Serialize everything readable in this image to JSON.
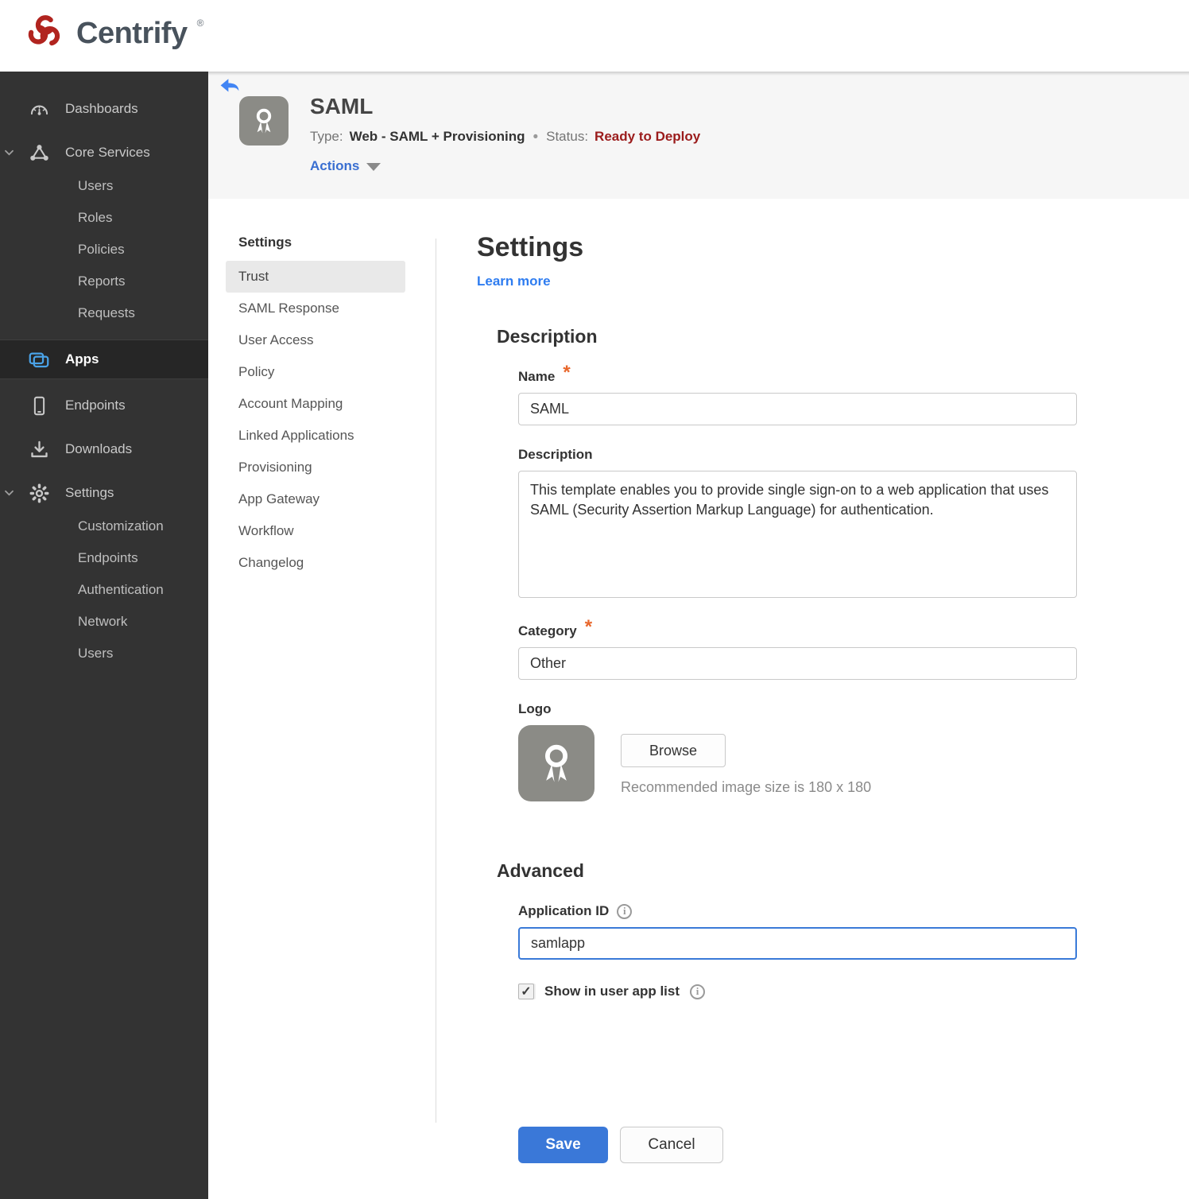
{
  "brand": {
    "name": "Centrify",
    "trademark": "®"
  },
  "colors": {
    "brand_red": "#b1241f",
    "sidebar_bg": "#333333",
    "sidebar_active_bg": "#262626",
    "apps_icon_blue": "#4aa3e8",
    "accent_blue": "#3a78d8",
    "link_blue": "#2e7cf0",
    "status_red": "#9b1c1c",
    "required_orange": "#e8672c"
  },
  "icons": {
    "info": "i",
    "checkmark": "✓",
    "meta_dot": "•"
  },
  "sidebar": {
    "items": [
      {
        "label": "Dashboards",
        "icon": "dashboards",
        "type": "top"
      },
      {
        "label": "Core Services",
        "icon": "core-services",
        "type": "top",
        "expanded": true
      },
      {
        "label": "Users",
        "type": "sub"
      },
      {
        "label": "Roles",
        "type": "sub"
      },
      {
        "label": "Policies",
        "type": "sub"
      },
      {
        "label": "Reports",
        "type": "sub"
      },
      {
        "label": "Requests",
        "type": "sub"
      },
      {
        "label": "Apps",
        "icon": "apps",
        "type": "top",
        "active": true
      },
      {
        "label": "Endpoints",
        "icon": "endpoints",
        "type": "top"
      },
      {
        "label": "Downloads",
        "icon": "downloads",
        "type": "top"
      },
      {
        "label": "Settings",
        "icon": "settings",
        "type": "top",
        "expanded": true
      },
      {
        "label": "Customization",
        "type": "sub"
      },
      {
        "label": "Endpoints",
        "type": "sub"
      },
      {
        "label": "Authentication",
        "type": "sub"
      },
      {
        "label": "Network",
        "type": "sub"
      },
      {
        "label": "Users",
        "type": "sub"
      }
    ]
  },
  "app_header": {
    "title": "SAML",
    "type_label": "Type:",
    "type_value": "Web - SAML + Provisioning",
    "status_label": "Status:",
    "status_value": "Ready to Deploy",
    "actions_label": "Actions"
  },
  "subnav": {
    "header": "Settings",
    "selected": "Trust",
    "items": [
      "Trust",
      "SAML Response",
      "User Access",
      "Policy",
      "Account Mapping",
      "Linked Applications",
      "Provisioning",
      "App Gateway",
      "Workflow",
      "Changelog"
    ]
  },
  "main": {
    "title": "Settings",
    "learn_more": "Learn more",
    "description_section": {
      "heading": "Description",
      "name_label": "Name",
      "name_value": "SAML",
      "description_label": "Description",
      "description_value": "This template enables you to provide single sign-on to a web application that uses SAML (Security Assertion Markup Language) for authentication.",
      "category_label": "Category",
      "category_value": "Other",
      "logo_label": "Logo",
      "browse_label": "Browse",
      "logo_hint": "Recommended image size is 180 x 180"
    },
    "advanced_section": {
      "heading": "Advanced",
      "application_id_label": "Application ID",
      "application_id_value": "samlapp",
      "show_in_app_list_label": "Show in user app list",
      "show_in_app_list_checked": true
    },
    "save_label": "Save",
    "cancel_label": "Cancel"
  }
}
